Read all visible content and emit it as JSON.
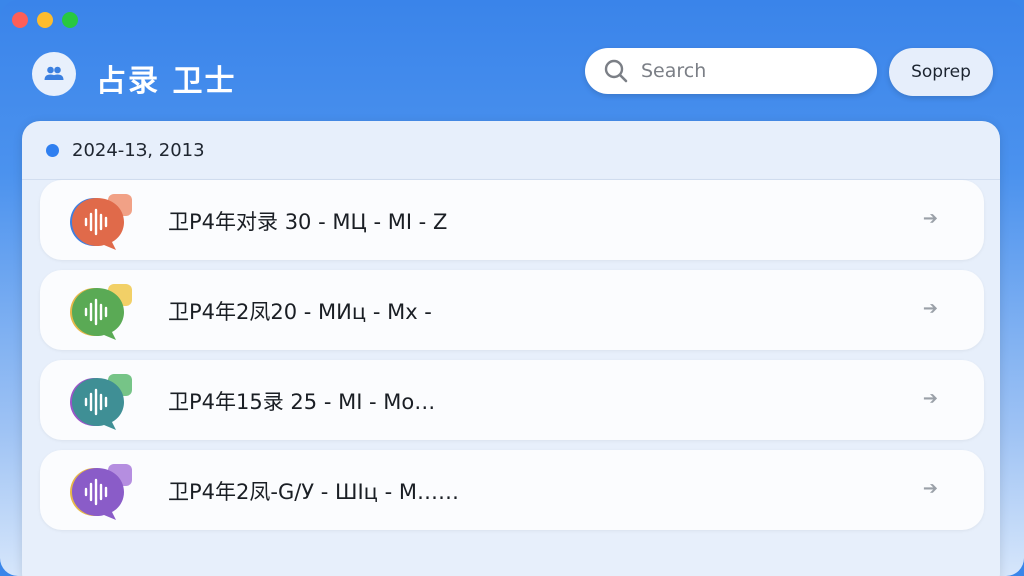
{
  "window": {
    "title": "占录 卫士"
  },
  "search": {
    "placeholder": "Search"
  },
  "header": {
    "action_label": "Soprep"
  },
  "group": {
    "date": "2024-1З, 2013"
  },
  "rows": [
    {
      "label": "卫P4年对录 30 - МЦ - MІ - Z",
      "icon": "voice-message-icon",
      "color": "#e06a4a",
      "accent": "#f1a186",
      "back": "#3f7fe0"
    },
    {
      "label": "卫P4年2凤20 - МИц - Mх -",
      "icon": "voice-message-icon",
      "color": "#5aaa55",
      "accent": "#f2d067",
      "back": "#e7b84a"
    },
    {
      "label": "卫P4年15录 25 - МІ - Mo…",
      "icon": "voice-message-icon",
      "color": "#3f8f95",
      "accent": "#76c487",
      "back": "#9a55c8"
    },
    {
      "label": "卫P4年2凤-G/У - ШІц - M……",
      "icon": "voice-message-icon",
      "color": "#8a5cc8",
      "accent": "#b58ee0",
      "back": "#e7b84a"
    }
  ],
  "row_arrow": "➔"
}
